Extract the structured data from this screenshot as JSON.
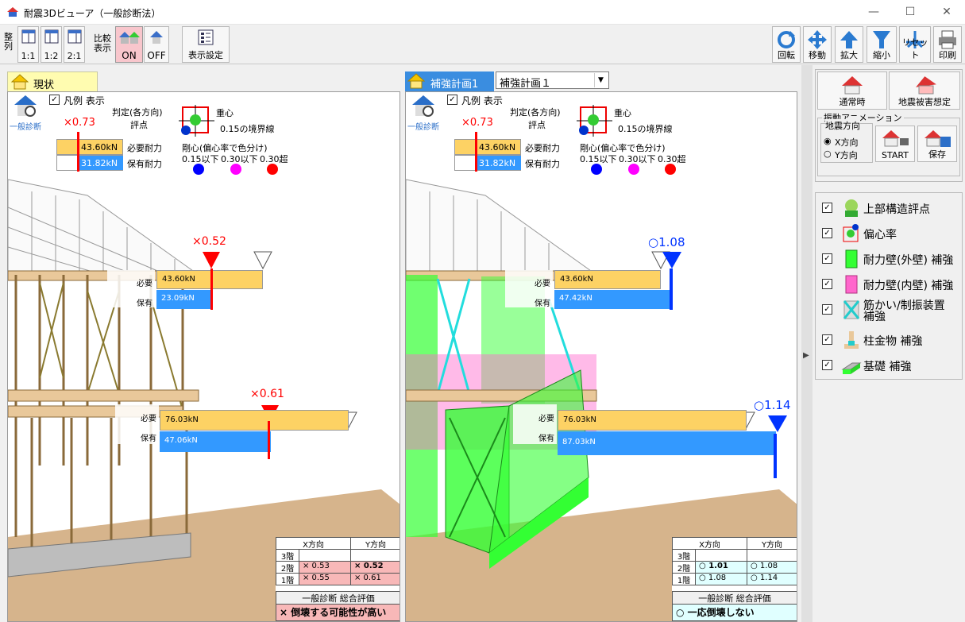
{
  "window": {
    "title": "耐震3Dビューア（一般診断法）",
    "minimize": "—",
    "maximize": "☐",
    "close": "✕"
  },
  "toolbar": {
    "arrange": "整列",
    "r11": "1:1",
    "r12": "1:2",
    "r21": "2:1",
    "compare": "比較表示",
    "on": "ON",
    "off": "OFF",
    "display_settings": "表示設定",
    "rotate": "回転",
    "move": "移動",
    "zoom_in": "拡大",
    "zoom_out": "縮小",
    "reset": "リセット",
    "print": "印刷"
  },
  "left": {
    "tab": "現状",
    "mode": "一般診断"
  },
  "right": {
    "tab": "補強計画1",
    "plan_select": "補強計画１"
  },
  "legend": {
    "show": "凡例 表示",
    "judge": "判定(各方向)",
    "score_label": "評点",
    "score": "×0.73",
    "required_val": "43.60kN",
    "held_val": "31.82kN",
    "required": "必要耐力",
    "held": "保有耐力",
    "cog": "重心",
    "boundary": "0.15の境界線",
    "rigidity": "剛心(偏心率で色分け)",
    "r1": "0.15以下",
    "r2": "0.30以下",
    "r3": "0.30超"
  },
  "left_view": {
    "f2_score": "×0.52",
    "f2_req_lbl": "必要",
    "f2_req": "43.60kN",
    "f2_hold_lbl": "保有",
    "f2_hold": "23.09kN",
    "f1_score": "×0.61",
    "f1_req_lbl": "必要",
    "f1_req": "76.03kN",
    "f1_hold_lbl": "保有",
    "f1_hold": "47.06kN"
  },
  "right_view": {
    "f2_score": "○1.08",
    "f2_req_lbl": "必要",
    "f2_req": "43.60kN",
    "f2_hold_lbl": "保有",
    "f2_hold": "47.42kN",
    "f1_score": "○1.14",
    "f1_req_lbl": "必要",
    "f1_req": "76.03kN",
    "f1_hold_lbl": "保有",
    "f1_hold": "87.03kN"
  },
  "left_table": {
    "hx": "X方向",
    "hy": "Y方向",
    "r3": "3階",
    "r2": "2階",
    "r2x": "× 0.53",
    "r2y": "× 0.52",
    "r1": "1階",
    "r1x": "× 0.55",
    "r1y": "× 0.61",
    "summary_title": "一般診断 総合評価",
    "summary": "× 倒壊する可能性が高い"
  },
  "right_table": {
    "hx": "X方向",
    "hy": "Y方向",
    "r3": "3階",
    "r2": "2階",
    "r2x": "○ 1.01",
    "r2y": "○ 1.08",
    "r1": "1階",
    "r1x": "○ 1.08",
    "r1y": "○ 1.14",
    "summary_title": "一般診断 総合評価",
    "summary": "○ 一応倒壊しない"
  },
  "sidebar": {
    "normal": "通常時",
    "quake": "地震被害想定",
    "anim_title": "振動アニメーション",
    "dir_title": "地震方向",
    "x_dir": "X方向",
    "y_dir": "Y方向",
    "start": "START",
    "save": "保存",
    "items": [
      {
        "label": "上部構造評点"
      },
      {
        "label": "偏心率"
      },
      {
        "label": "耐力壁(外壁) 補強"
      },
      {
        "label": "耐力壁(内壁) 補強"
      },
      {
        "label": "筋かい/制振装置"
      },
      {
        "label": "補強"
      },
      {
        "label": "柱金物 補強"
      },
      {
        "label": "基礎 補強"
      }
    ]
  },
  "colors": {
    "required": "#fdd264",
    "held": "#3399ff",
    "bad": "#ff0000",
    "good": "#0033ff",
    "green": "#33ff33",
    "pink": "#ff66cc"
  }
}
